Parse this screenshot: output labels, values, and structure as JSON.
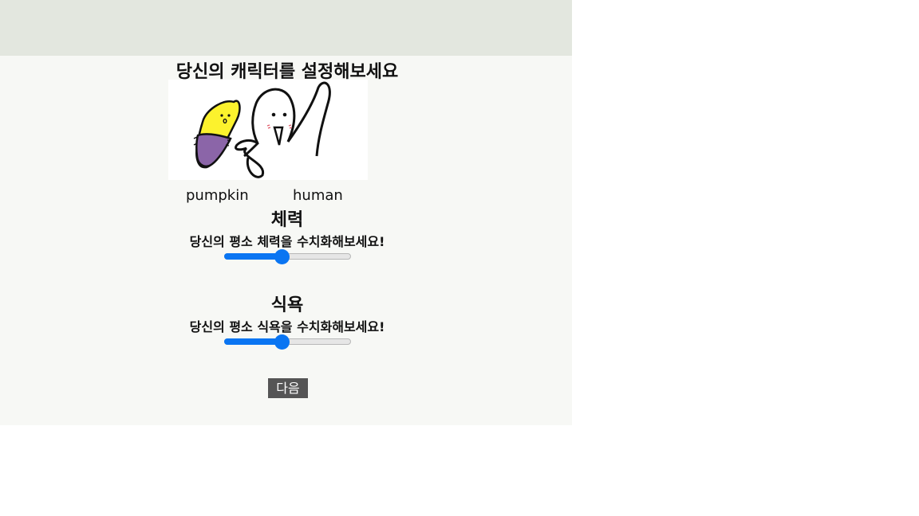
{
  "title": "당신의 캐릭터를 설정해보세요",
  "characters": [
    {
      "label": "pumpkin",
      "icon": "sweet-potato-character-icon"
    },
    {
      "label": "human",
      "icon": "ghost-human-character-icon"
    }
  ],
  "stats": [
    {
      "title": "체력",
      "description": "당신의 평소 체력을 수치화해보세요!",
      "value_fraction": 0.45
    },
    {
      "title": "식욕",
      "description": "당신의 평소 식욕을 수치화해보세요!",
      "value_fraction": 0.45
    }
  ],
  "next_button": {
    "label": "다음"
  },
  "colors": {
    "accent": "#0a75f2",
    "button": "#555555",
    "header": "#e3e7df",
    "background": "#f7f8f5"
  }
}
